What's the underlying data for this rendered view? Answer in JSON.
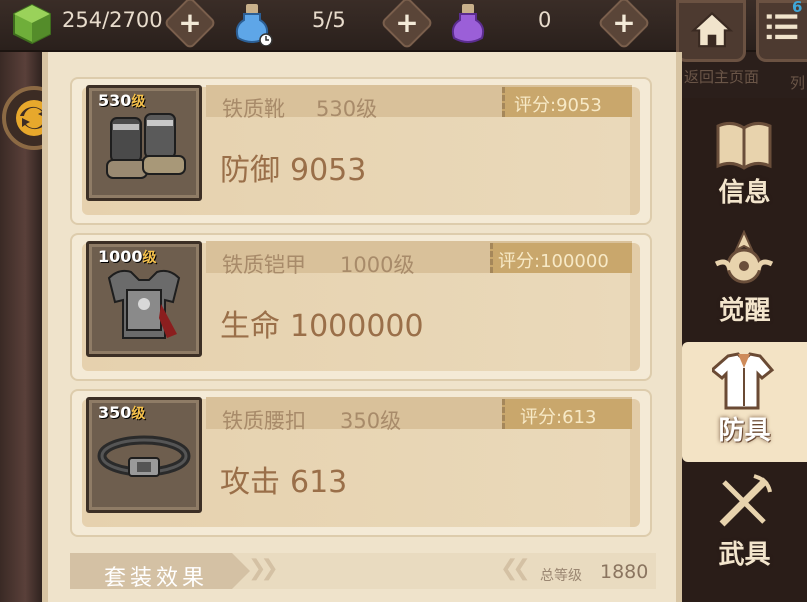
{
  "top_bar": {
    "stamina": "254/2700",
    "potion_blue": "5/5",
    "potion_purple": "0",
    "plus": "+",
    "home_caption": "返回主页面",
    "list_caption": "列",
    "badge": "6"
  },
  "items": [
    {
      "level_num": "530",
      "level_suffix": "级",
      "name": "铁质靴",
      "level_text": "530级",
      "score": "评分:9053",
      "stat_name": "防御",
      "stat_value": "9053"
    },
    {
      "level_num": "1000",
      "level_suffix": "级",
      "name": "铁质铠甲",
      "level_text": "1000级",
      "score": "评分:100000",
      "stat_name": "生命",
      "stat_value": "1000000"
    },
    {
      "level_num": "350",
      "level_suffix": "级",
      "name": "铁质腰扣",
      "level_text": "350级",
      "score": "评分:613",
      "stat_name": "攻击",
      "stat_value": "613"
    }
  ],
  "set_bar": {
    "label": "套装效果",
    "total_label": "总等级",
    "total_value": "1880"
  },
  "sidebar": [
    {
      "label": "信息",
      "active": false
    },
    {
      "label": "觉醒",
      "active": false
    },
    {
      "label": "防具",
      "active": true
    },
    {
      "label": "武具",
      "active": false
    }
  ],
  "colors": {
    "panel": "#efe3cb",
    "accent": "#c9a76c",
    "stat_text": "#9a6f49",
    "dark_bg": "#2a1d18"
  }
}
